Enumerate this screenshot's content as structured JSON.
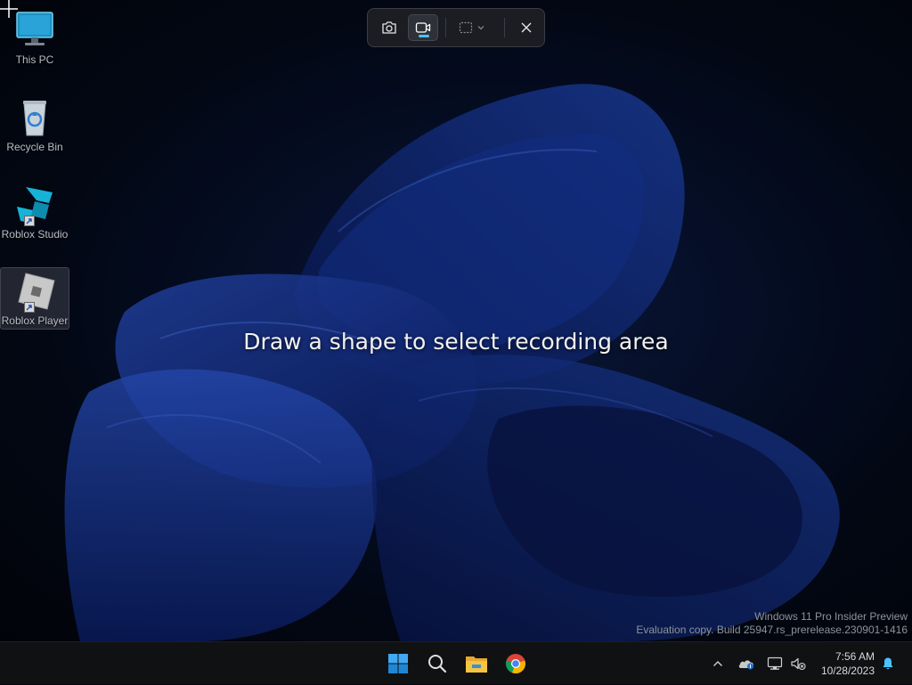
{
  "desktop": {
    "icons": [
      {
        "label": "This PC",
        "icon": "monitor-icon"
      },
      {
        "label": "Recycle Bin",
        "icon": "recycle-bin-icon"
      },
      {
        "label": "Roblox Studio",
        "icon": "roblox-studio-icon"
      },
      {
        "label": "Roblox Player",
        "icon": "roblox-player-icon",
        "selected": true
      }
    ]
  },
  "capture_toolbar": {
    "buttons": [
      {
        "icon": "camera-icon",
        "name": "Screenshot mode"
      },
      {
        "icon": "video-camera-icon",
        "name": "Record mode",
        "active": true
      },
      {
        "icon": "rectangle-selection-icon",
        "name": "Selection shape"
      },
      {
        "icon": "close-icon",
        "name": "Close"
      }
    ],
    "accent": "#4cc2ff"
  },
  "overlay": {
    "instruction": "Draw a shape to select recording area"
  },
  "watermark": {
    "line1": "Windows 11 Pro Insider Preview",
    "line2": "Evaluation copy. Build 25947.rs_prerelease.230901-1416"
  },
  "taskbar": {
    "apps": [
      {
        "icon": "windows-start-icon"
      },
      {
        "icon": "search-icon"
      },
      {
        "icon": "file-explorer-icon"
      },
      {
        "icon": "chrome-icon"
      }
    ],
    "tray": {
      "icons": [
        "chevron-up-icon",
        "onedrive-icon",
        "network-icon",
        "volume-muted-icon",
        "notification-bell-icon"
      ]
    },
    "clock": {
      "time": "7:56 AM",
      "date": "10/28/2023"
    }
  }
}
